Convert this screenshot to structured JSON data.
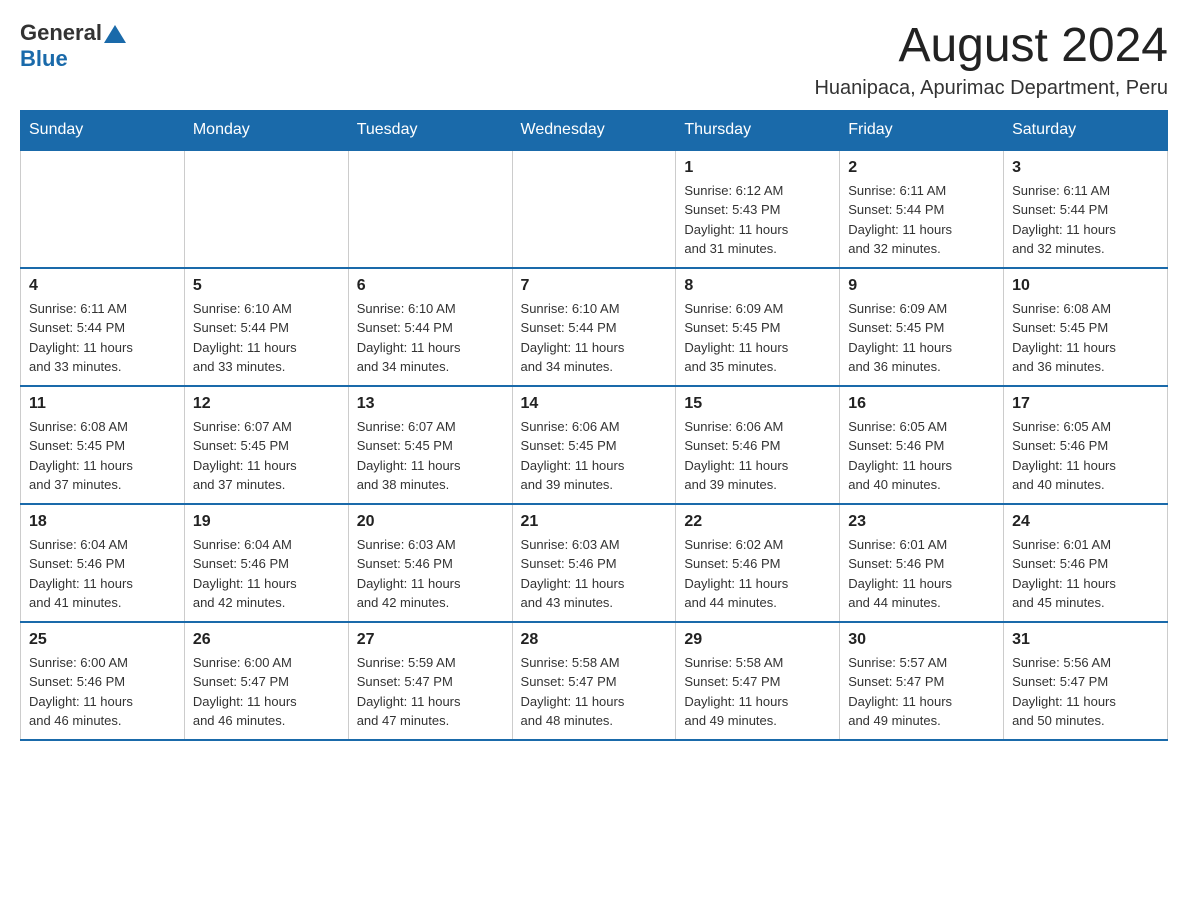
{
  "header": {
    "logo_general": "General",
    "logo_blue": "Blue",
    "month_title": "August 2024",
    "location": "Huanipaca, Apurimac Department, Peru"
  },
  "weekdays": [
    "Sunday",
    "Monday",
    "Tuesday",
    "Wednesday",
    "Thursday",
    "Friday",
    "Saturday"
  ],
  "weeks": [
    [
      {
        "day": "",
        "info": ""
      },
      {
        "day": "",
        "info": ""
      },
      {
        "day": "",
        "info": ""
      },
      {
        "day": "",
        "info": ""
      },
      {
        "day": "1",
        "info": "Sunrise: 6:12 AM\nSunset: 5:43 PM\nDaylight: 11 hours\nand 31 minutes."
      },
      {
        "day": "2",
        "info": "Sunrise: 6:11 AM\nSunset: 5:44 PM\nDaylight: 11 hours\nand 32 minutes."
      },
      {
        "day": "3",
        "info": "Sunrise: 6:11 AM\nSunset: 5:44 PM\nDaylight: 11 hours\nand 32 minutes."
      }
    ],
    [
      {
        "day": "4",
        "info": "Sunrise: 6:11 AM\nSunset: 5:44 PM\nDaylight: 11 hours\nand 33 minutes."
      },
      {
        "day": "5",
        "info": "Sunrise: 6:10 AM\nSunset: 5:44 PM\nDaylight: 11 hours\nand 33 minutes."
      },
      {
        "day": "6",
        "info": "Sunrise: 6:10 AM\nSunset: 5:44 PM\nDaylight: 11 hours\nand 34 minutes."
      },
      {
        "day": "7",
        "info": "Sunrise: 6:10 AM\nSunset: 5:44 PM\nDaylight: 11 hours\nand 34 minutes."
      },
      {
        "day": "8",
        "info": "Sunrise: 6:09 AM\nSunset: 5:45 PM\nDaylight: 11 hours\nand 35 minutes."
      },
      {
        "day": "9",
        "info": "Sunrise: 6:09 AM\nSunset: 5:45 PM\nDaylight: 11 hours\nand 36 minutes."
      },
      {
        "day": "10",
        "info": "Sunrise: 6:08 AM\nSunset: 5:45 PM\nDaylight: 11 hours\nand 36 minutes."
      }
    ],
    [
      {
        "day": "11",
        "info": "Sunrise: 6:08 AM\nSunset: 5:45 PM\nDaylight: 11 hours\nand 37 minutes."
      },
      {
        "day": "12",
        "info": "Sunrise: 6:07 AM\nSunset: 5:45 PM\nDaylight: 11 hours\nand 37 minutes."
      },
      {
        "day": "13",
        "info": "Sunrise: 6:07 AM\nSunset: 5:45 PM\nDaylight: 11 hours\nand 38 minutes."
      },
      {
        "day": "14",
        "info": "Sunrise: 6:06 AM\nSunset: 5:45 PM\nDaylight: 11 hours\nand 39 minutes."
      },
      {
        "day": "15",
        "info": "Sunrise: 6:06 AM\nSunset: 5:46 PM\nDaylight: 11 hours\nand 39 minutes."
      },
      {
        "day": "16",
        "info": "Sunrise: 6:05 AM\nSunset: 5:46 PM\nDaylight: 11 hours\nand 40 minutes."
      },
      {
        "day": "17",
        "info": "Sunrise: 6:05 AM\nSunset: 5:46 PM\nDaylight: 11 hours\nand 40 minutes."
      }
    ],
    [
      {
        "day": "18",
        "info": "Sunrise: 6:04 AM\nSunset: 5:46 PM\nDaylight: 11 hours\nand 41 minutes."
      },
      {
        "day": "19",
        "info": "Sunrise: 6:04 AM\nSunset: 5:46 PM\nDaylight: 11 hours\nand 42 minutes."
      },
      {
        "day": "20",
        "info": "Sunrise: 6:03 AM\nSunset: 5:46 PM\nDaylight: 11 hours\nand 42 minutes."
      },
      {
        "day": "21",
        "info": "Sunrise: 6:03 AM\nSunset: 5:46 PM\nDaylight: 11 hours\nand 43 minutes."
      },
      {
        "day": "22",
        "info": "Sunrise: 6:02 AM\nSunset: 5:46 PM\nDaylight: 11 hours\nand 44 minutes."
      },
      {
        "day": "23",
        "info": "Sunrise: 6:01 AM\nSunset: 5:46 PM\nDaylight: 11 hours\nand 44 minutes."
      },
      {
        "day": "24",
        "info": "Sunrise: 6:01 AM\nSunset: 5:46 PM\nDaylight: 11 hours\nand 45 minutes."
      }
    ],
    [
      {
        "day": "25",
        "info": "Sunrise: 6:00 AM\nSunset: 5:46 PM\nDaylight: 11 hours\nand 46 minutes."
      },
      {
        "day": "26",
        "info": "Sunrise: 6:00 AM\nSunset: 5:47 PM\nDaylight: 11 hours\nand 46 minutes."
      },
      {
        "day": "27",
        "info": "Sunrise: 5:59 AM\nSunset: 5:47 PM\nDaylight: 11 hours\nand 47 minutes."
      },
      {
        "day": "28",
        "info": "Sunrise: 5:58 AM\nSunset: 5:47 PM\nDaylight: 11 hours\nand 48 minutes."
      },
      {
        "day": "29",
        "info": "Sunrise: 5:58 AM\nSunset: 5:47 PM\nDaylight: 11 hours\nand 49 minutes."
      },
      {
        "day": "30",
        "info": "Sunrise: 5:57 AM\nSunset: 5:47 PM\nDaylight: 11 hours\nand 49 minutes."
      },
      {
        "day": "31",
        "info": "Sunrise: 5:56 AM\nSunset: 5:47 PM\nDaylight: 11 hours\nand 50 minutes."
      }
    ]
  ]
}
